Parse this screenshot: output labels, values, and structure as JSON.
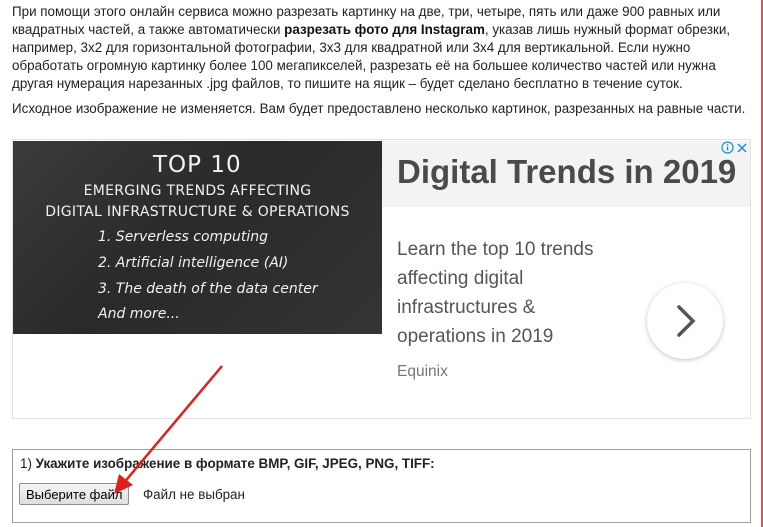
{
  "intro": {
    "part1": "При помощи этого онлайн сервиса можно разрезать картинку на две, три, четыре, пять или даже 900 равных или квадратных частей, а также автоматически ",
    "bold": "разрезать фото для Instagram",
    "part2": ", указав лишь нужный формат обрезки, например, 3x2 для горизонтальной фотографии, 3x3 для квадратной или 3x4 для вертикальной. Если нужно обработать огромную картинку более 100 мегапикселей, разрезать её на большее количество частей или нужна другая нумерация нарезанных .jpg файлов, то пишите на ящик – будет сделано бесплатно в течение суток."
  },
  "note": "Исходное изображение не изменяется. Вам будет предоставлено несколько картинок, разрезанных на равные части.",
  "ad": {
    "image": {
      "title": "TOP 10",
      "subtitle_1": "EMERGING TRENDS AFFECTING",
      "subtitle_2": "DIGITAL INFRASTRUCTURE & OPERATIONS",
      "items": [
        "1. Serverless computing",
        "2. Artificial intelligence (AI)",
        "3. The death of the data center",
        "And more..."
      ]
    },
    "headline": "Digital Trends in 2019",
    "body": "Learn the top 10 trends affecting digital infrastructures & operations in 2019",
    "advertiser": "Equinix",
    "adchoices_icon": "info-icon",
    "close_icon": "close-icon",
    "arrow_icon": "chevron-right-icon"
  },
  "upload": {
    "number": "1)",
    "label": "Укажите изображение в формате BMP, GIF, JPEG, PNG, TIFF:",
    "button": "Выберите файл",
    "status": "Файл не выбран"
  },
  "colors": {
    "accent_red": "#e0201b",
    "ad_link": "#1a8fd6"
  }
}
